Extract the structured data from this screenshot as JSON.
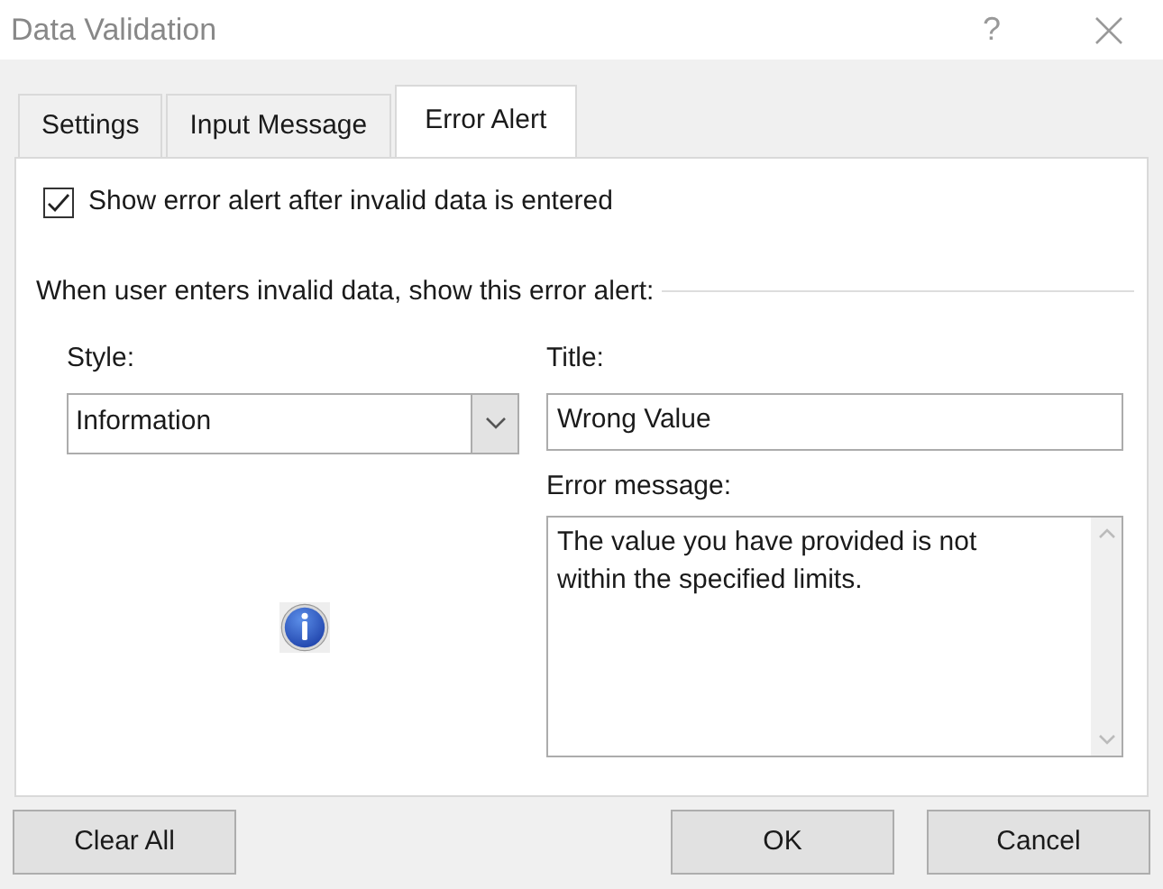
{
  "window": {
    "title": "Data Validation",
    "help": "?"
  },
  "tabs": [
    {
      "label": "Settings",
      "selected": false
    },
    {
      "label": "Input Message",
      "selected": false
    },
    {
      "label": "Error Alert",
      "selected": true
    }
  ],
  "show_alert": {
    "label": "Show error alert after invalid data is entered",
    "checked": true
  },
  "group_heading": "When user enters invalid data, show this error alert:",
  "style": {
    "label": "Style:",
    "value": "Information"
  },
  "title": {
    "label": "Title:",
    "value": "Wrong Value"
  },
  "error_message": {
    "label": "Error message:",
    "value": "The value you have provided is not within the specified limits."
  },
  "buttons": [
    {
      "label": "Clear All",
      "kind": "left"
    },
    {
      "label": "OK",
      "kind": "right"
    },
    {
      "label": "Cancel",
      "kind": "right"
    }
  ]
}
